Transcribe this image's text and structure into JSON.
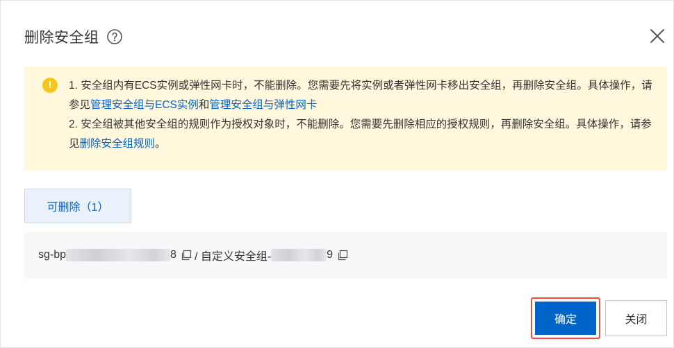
{
  "dialog": {
    "title": "删除安全组",
    "help_icon": "question-circle-icon",
    "close_icon": "close-x-icon"
  },
  "alert": {
    "icon": "warning-exclamation-icon",
    "line1_prefix": "1. 安全组内有ECS实例或弹性网卡时，不能删除。您需要先将实例或者弹性网卡移出安全组，再删除安全组。具体操作，请参见",
    "link1": "管理安全组与ECS实例",
    "line1_mid": "和",
    "link2": "管理安全组与弹性网卡",
    "line2_prefix": "2. 安全组被其他安全组的规则作为授权对象时，不能删除。您需要先删除相应的授权规则，再删除安全组。具体操作，请参见",
    "link3": "删除安全组规则",
    "line2_suffix": "。"
  },
  "tab": {
    "label": "可删除（1）"
  },
  "list": {
    "id_prefix": "sg-bp",
    "id_suffix": "8",
    "name_prefix": "/ 自定义安全组-",
    "name_suffix": "9",
    "copy_icon": "copy-icon"
  },
  "footer": {
    "ok_label": "确定",
    "close_label": "关闭"
  },
  "colors": {
    "primary": "#0064c8",
    "alert_bg": "#fff8dc",
    "highlight_border": "#ef4b3b",
    "warning_icon": "#f5c518"
  }
}
